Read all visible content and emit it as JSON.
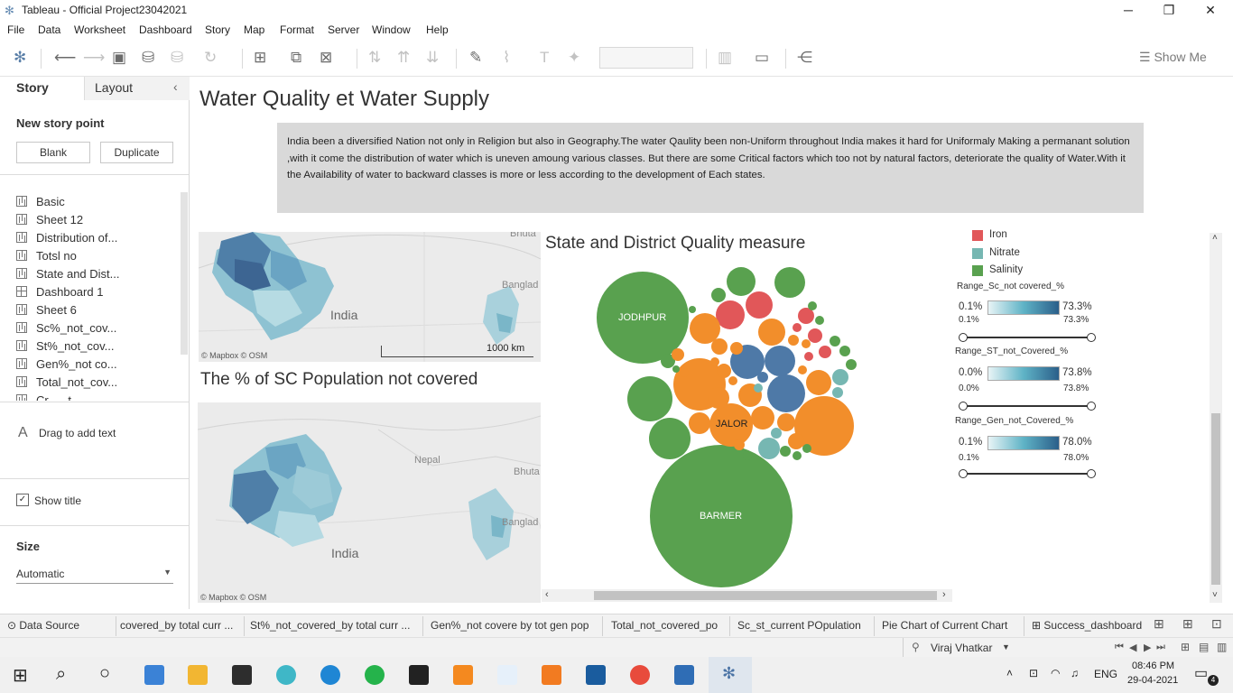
{
  "window": {
    "title": "Tableau - Official Project23042021"
  },
  "menu": [
    "File",
    "Data",
    "Worksheet",
    "Dashboard",
    "Story",
    "Map",
    "Format",
    "Server",
    "Window",
    "Help"
  ],
  "toolbar": {
    "show_me": "Show Me"
  },
  "left_pane": {
    "tabs": [
      "Story",
      "Layout"
    ],
    "new_story_point": "New story point",
    "blank_button": "Blank",
    "duplicate_button": "Duplicate",
    "sheets": [
      "Basic",
      "Sheet 12",
      "Distribution of...",
      "Totsl no",
      "State and Dist...",
      "Dashboard 1",
      "Sheet 6",
      "Sc%_not_cov...",
      "St%_not_cov...",
      "Gen%_not co...",
      "Total_not_cov...",
      "Cr___t ____ _"
    ],
    "drag_text": "Drag to add text",
    "show_title": "Show title",
    "size_label": "Size",
    "size_value": "Automatic"
  },
  "story": {
    "title": "Water Quality et Water Supply",
    "description": "India been a diversified Nation not only in Religion but also in  Geography.The water Qaulity been non-Uniform throughout India makes it hard for Uniformaly Making a permanant solution ,with it come the distribution of water which is uneven amoung various classes. But there are some Critical factors which too not by natural factors, deteriorate the quality of Water.With it the Availability of water to backward classes is more or less according to the development of Each states."
  },
  "map_top": {
    "labels": [
      "India",
      "Bhuta",
      "Banglad"
    ],
    "credit": "© Mapbox © OSM",
    "scale": "1000 km"
  },
  "map_bottom": {
    "title": "The % of SC Population not covered",
    "labels": [
      "India",
      "Nepal",
      "Bhuta",
      "Banglad"
    ],
    "credit": "© Mapbox © OSM"
  },
  "bubble": {
    "title": "State and District Quality measure",
    "labels": {
      "jodhpur": "JODHPUR",
      "jalor": "JALOR",
      "barmer": "BARMER"
    }
  },
  "legend": {
    "items": [
      {
        "name": "Iron",
        "color": "#e15759"
      },
      {
        "name": "Nitrate",
        "color": "#76b7b2"
      },
      {
        "name": "Salinity",
        "color": "#59a14f"
      }
    ],
    "ranges": [
      {
        "title": "Range_Sc_not covered_%",
        "min": "0.1%",
        "max": "73.3%",
        "min2": "0.1%",
        "max2": "73.3%"
      },
      {
        "title": "Range_ST_not_Covered_%",
        "min": "0.0%",
        "max": "73.8%",
        "min2": "0.0%",
        "max2": "73.8%"
      },
      {
        "title": "Range_Gen_not_Covered_%",
        "min": "0.1%",
        "max": "78.0%",
        "min2": "0.1%",
        "max2": "78.0%"
      }
    ]
  },
  "bottom_tabs": [
    "Data Source",
    "covered_by total curr ...",
    "St%_not_covered_by total curr ...",
    "Gen%_not covere by tot gen pop",
    "Total_not_covered_po",
    "Sc_st_current POpulation",
    "Pie Chart of Current Chart",
    "Success_dashboard"
  ],
  "status": {
    "user": "Viraj Vhatkar"
  },
  "taskbar": {
    "lang": "ENG",
    "time": "08:46 PM",
    "date": "29-04-2021",
    "notif": "4"
  },
  "colors": {
    "orange": "#f28e2b",
    "blue": "#4e79a7",
    "green": "#59a14f",
    "red": "#e15759",
    "teal": "#76b7b2"
  }
}
